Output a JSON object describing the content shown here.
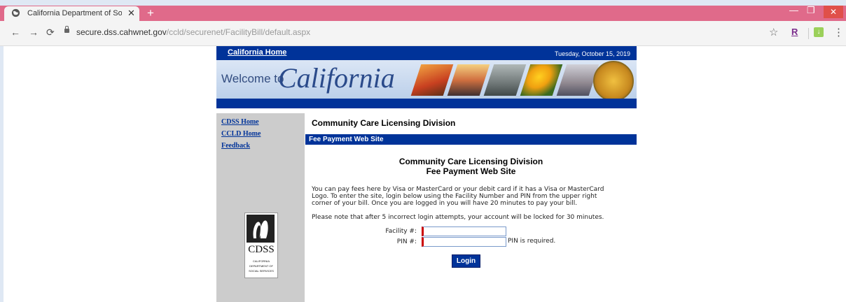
{
  "browser": {
    "tab_title": "California Department of Social S",
    "url_host": "secure.dss.cahwnet.gov",
    "url_path": "/ccld/securenet/FacilityBill/default.aspx",
    "extension_label": "R"
  },
  "header": {
    "home_link": "California Home",
    "date": "Tuesday, October 15, 2019",
    "banner_welcome": "Welcome to",
    "banner_title": "California"
  },
  "sidebar": {
    "items": [
      {
        "label": "CDSS Home"
      },
      {
        "label": "CCLD Home"
      },
      {
        "label": "Feedback"
      }
    ],
    "logo": {
      "text": "CDSS",
      "line1": "CALIFORNIA",
      "line2": "DEPARTMENT OF",
      "line3": "SOCIAL SERVICES"
    }
  },
  "main": {
    "division_title": "Community Care Licensing Division",
    "section_bar": "Fee Payment Web Site",
    "heading_line1": "Community Care Licensing Division",
    "heading_line2": "Fee Payment Web Site",
    "intro_lines": [
      "You can pay fees here by Visa or MasterCard or your debit card if it has a Visa or MasterCard",
      "Logo. To enter the site, login below using the Facility Number and PIN from the upper right",
      "corner of your bill. Once you are logged in you will have 20 minutes to pay your bill."
    ],
    "lock_notice": "Please note that after 5 incorrect login attempts, your account will be locked for 30 minutes.",
    "facility_label": "Facility #:",
    "facility_value": "",
    "pin_label": "PIN #:",
    "pin_value": "",
    "pin_required": "PIN is required.",
    "login_button": "Login"
  },
  "colors": {
    "accent": "#003399",
    "titlebar": "#e06a8a",
    "sidebar": "#cccccc",
    "required_marker": "#cc0000"
  }
}
